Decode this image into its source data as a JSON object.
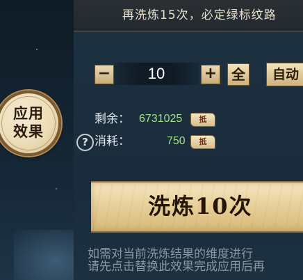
{
  "banner": {
    "text": "再洗炼15次，必定绿标纹路"
  },
  "apply": {
    "label_line1": "应用",
    "label_line2": "效果"
  },
  "stepper": {
    "minus": "−",
    "value": "10",
    "plus": "+"
  },
  "buttons": {
    "all": "全",
    "auto": "自动"
  },
  "resources": {
    "remaining_label": "剩余：",
    "remaining_value": "6731025",
    "cost_label": "消耗：",
    "cost_value": "750",
    "token_text": "抵",
    "help": "?"
  },
  "wash": {
    "label": "洗炼10次"
  },
  "hint": {
    "line1": "如需对当前洗炼结果的维度进行",
    "line2": "请先点击替换此效果完成应用后再"
  },
  "colors": {
    "accent": "#e8d19c",
    "value_green": "#a6e08a",
    "panel": "#1c2f3f"
  },
  "icons": [
    "minus-icon",
    "plus-icon",
    "token-icon",
    "help-icon"
  ]
}
